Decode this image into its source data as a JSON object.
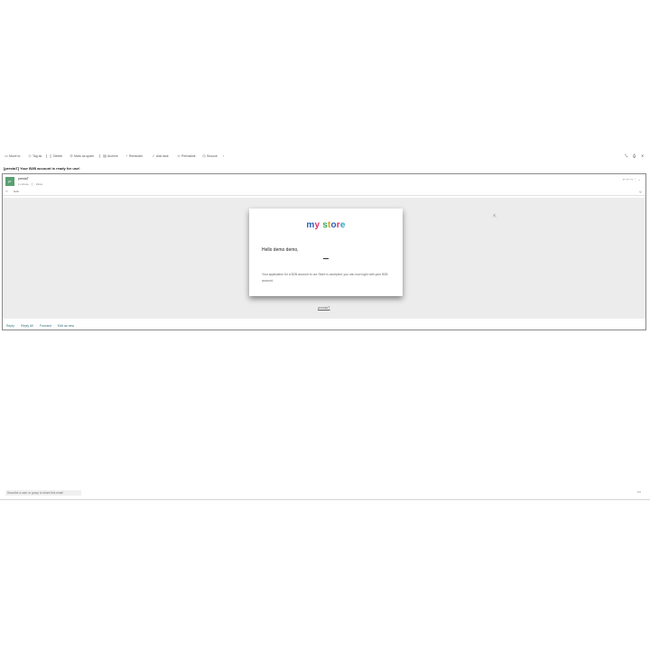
{
  "toolbar": {
    "move_to": "Move to",
    "tag_as": "Tag as",
    "delete": "Delete",
    "mark_as_spam": "Mark as spam",
    "archive": "Archive",
    "reminder": "Reminder",
    "add_task": "Add task",
    "permalink": "Permalink",
    "snooze": "Snooze",
    "more": "›"
  },
  "email": {
    "subject": "[prestaT] Your B2B account is ready for use!",
    "avatar_initials": "pr",
    "sender": "prestaT",
    "meta": "1 minute · ⓘ · Inbox",
    "to_label": "hello",
    "logo": {
      "letters": [
        {
          "ch": "m",
          "color": "#2b5fb5"
        },
        {
          "ch": "y",
          "color": "#d9306b"
        },
        {
          "ch": " ",
          "color": "#000000"
        },
        {
          "ch": "s",
          "color": "#2eaa5a"
        },
        {
          "ch": "t",
          "color": "#e59a1f"
        },
        {
          "ch": "o",
          "color": "#2b5fb5"
        },
        {
          "ch": "r",
          "color": "#d9306b"
        },
        {
          "ch": "e",
          "color": "#2ba6c9"
        }
      ]
    },
    "greeting": "Hello demo demo,",
    "message": "Your application for a B2B account to our Store is accepted, you can now login with your B2B account.",
    "footer_link": "prestaT"
  },
  "actions": {
    "reply": "Reply",
    "reply_all": "Reply All",
    "forward": "Forward",
    "edit_as_new": "Edit as new"
  },
  "share": {
    "placeholder": "Describe a user or group to share this email"
  }
}
